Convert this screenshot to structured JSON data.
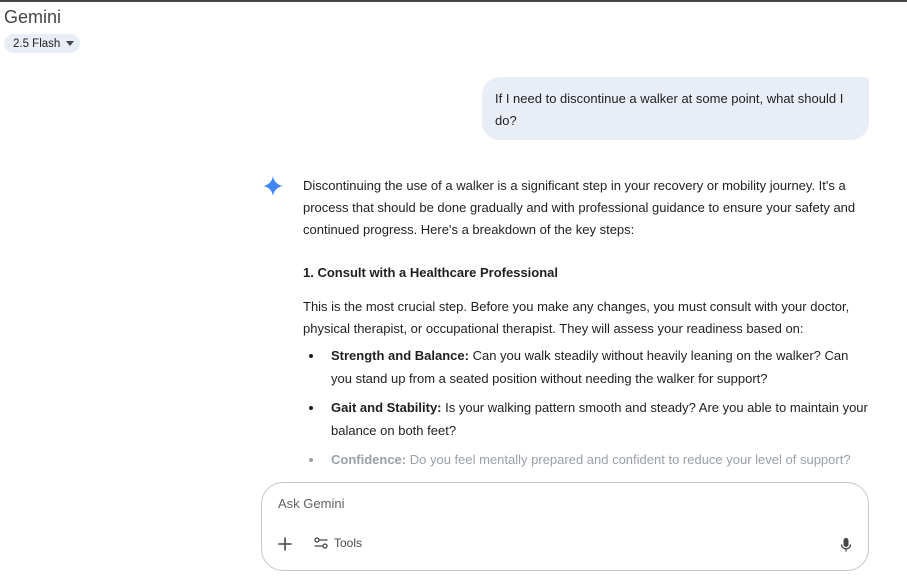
{
  "header": {
    "title": "Gemini",
    "model": "2.5 Flash"
  },
  "user_message": "If I need to discontinue a walker at some point, what should I do?",
  "response": {
    "intro": "Discontinuing the use of a walker is a significant step in your recovery or mobility journey. It's a process that should be done gradually and with professional guidance to ensure your safety and continued progress. Here's a breakdown of the key steps:",
    "heading": "1. Consult with a Healthcare Professional",
    "lead": "This is the most crucial step. Before you make any changes, you must consult with your doctor, physical therapist, or occupational therapist. They will assess your readiness based on:",
    "bullets": [
      {
        "term": "Strength and Balance:",
        "text": " Can you walk steadily without heavily leaning on the walker? Can you stand up from a seated position without needing the walker for support?"
      },
      {
        "term": "Gait and Stability:",
        "text": " Is your walking pattern smooth and steady? Are you able to maintain your balance on both feet?"
      },
      {
        "term": "Confidence:",
        "text": " Do you feel mentally prepared and confident to reduce your level of support?"
      }
    ]
  },
  "composer": {
    "placeholder": "Ask Gemini",
    "tools_label": "Tools"
  },
  "icons": {
    "spark": "gemini-spark-icon",
    "plus": "plus-icon",
    "tools": "tools-sliders-icon",
    "mic": "microphone-icon",
    "caret": "caret-down-icon"
  },
  "colors": {
    "spark": "#4285f4",
    "bubble": "#e9eef6",
    "border": "#c4c7c5"
  }
}
